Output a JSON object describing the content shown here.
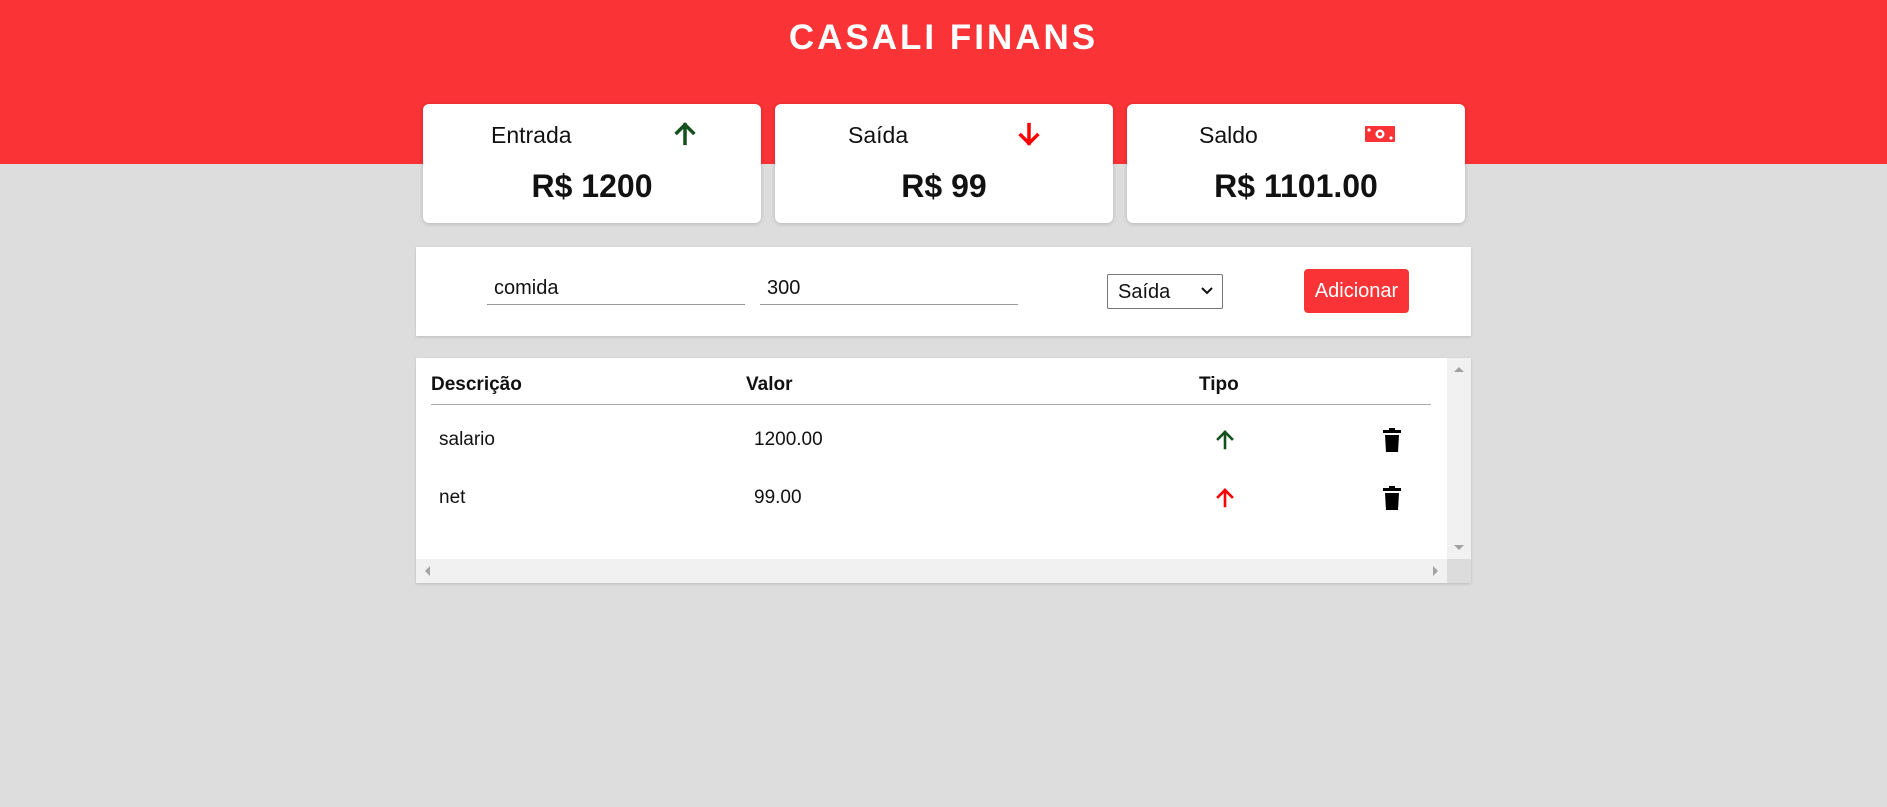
{
  "app": {
    "title": "CASALI FINANS"
  },
  "colors": {
    "brand": "#f93336",
    "income": "#14501c",
    "expense": "#ff0000",
    "background": "#dddddd"
  },
  "summary": {
    "income": {
      "label": "Entrada",
      "value": "R$ 1200",
      "icon": "arrow-up-icon"
    },
    "expense": {
      "label": "Saída",
      "value": "R$ 99",
      "icon": "arrow-down-icon"
    },
    "balance": {
      "label": "Saldo",
      "value": "R$ 1101.00",
      "icon": "money-bill-icon"
    }
  },
  "form": {
    "description_value": "comida",
    "amount_value": "300",
    "type_selected": "Saída",
    "add_label": "Adicionar"
  },
  "table": {
    "headers": {
      "description": "Descrição",
      "value": "Valor",
      "type": "Tipo"
    },
    "rows": [
      {
        "description": "salario",
        "value": "1200.00",
        "type_icon": "arrow-up-icon",
        "type_color": "#14501c"
      },
      {
        "description": "net",
        "value": "99.00",
        "type_icon": "arrow-up-icon",
        "type_color": "#ff0000"
      }
    ]
  }
}
